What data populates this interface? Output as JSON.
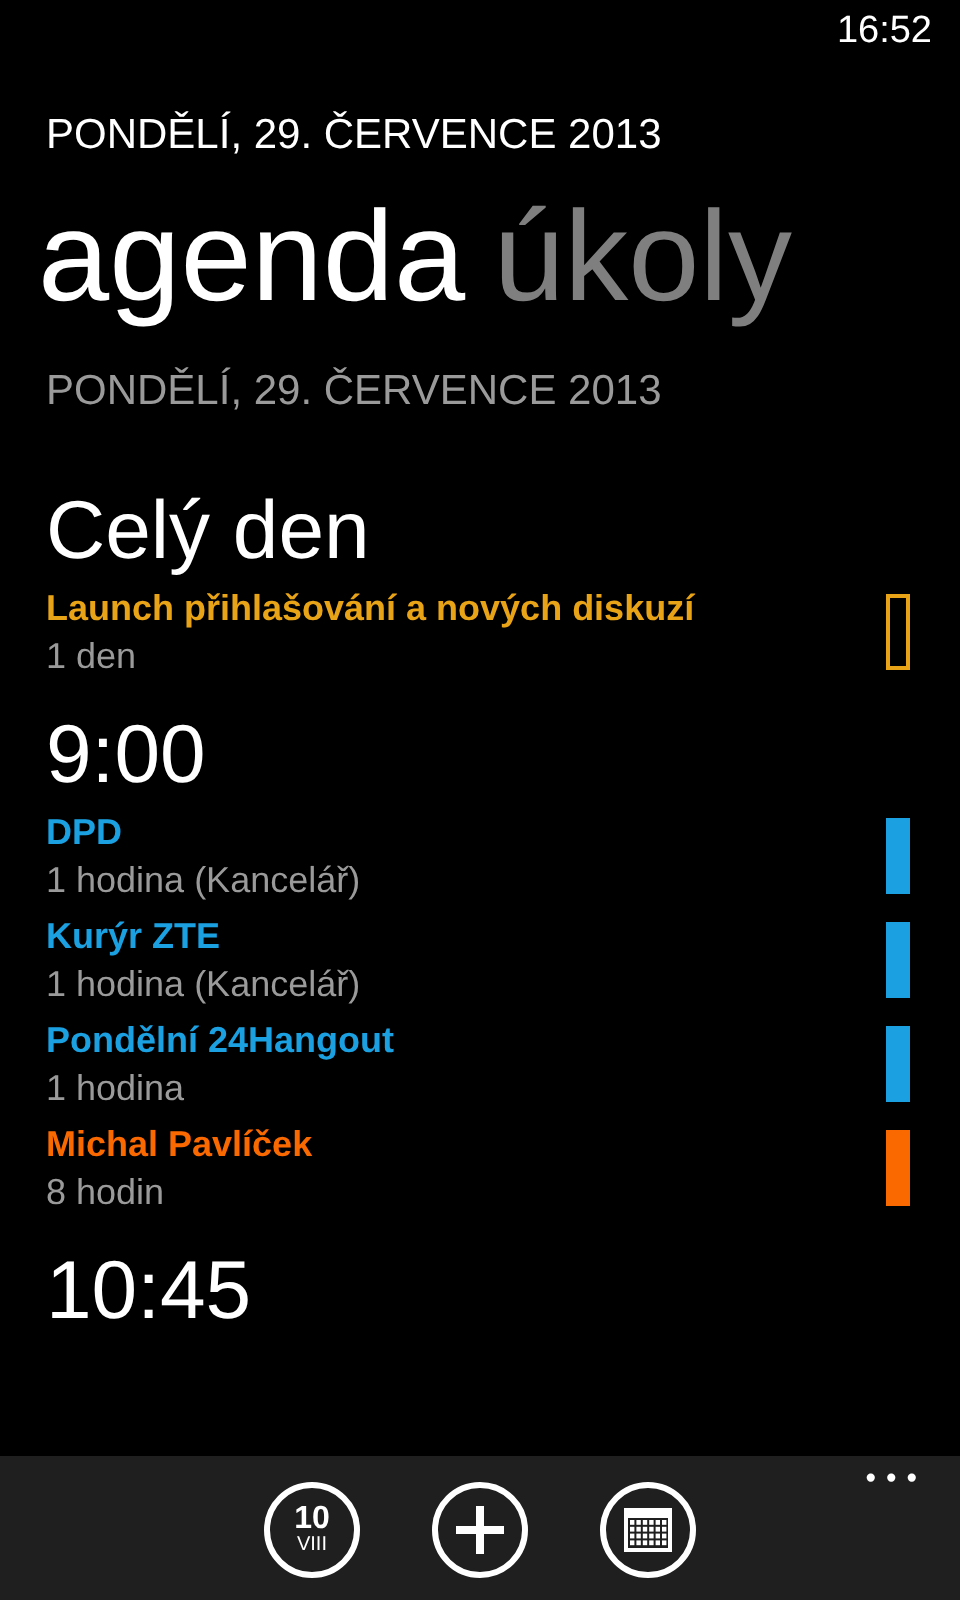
{
  "status_bar": {
    "time": "16:52"
  },
  "app_title": "PONDĚLÍ, 29. ČERVENCE 2013",
  "pivots": [
    {
      "label": "agenda",
      "selected": true
    },
    {
      "label": "úkoly",
      "selected": false
    }
  ],
  "day_heading": "PONDĚLÍ, 29. ČERVENCE 2013",
  "groups": [
    {
      "heading": "Celý den",
      "events": [
        {
          "title": "Launch přihlašování a nových diskuzí",
          "detail": "1 den",
          "color": "#e8a317",
          "busy": false
        }
      ]
    },
    {
      "heading": "9:00",
      "events": [
        {
          "title": "DPD",
          "detail": "1 hodina (Kancelář)",
          "color": "#1ba1e2",
          "busy": true
        },
        {
          "title": "Kurýr ZTE",
          "detail": "1 hodina (Kancelář)",
          "color": "#1ba1e2",
          "busy": true
        },
        {
          "title": "Pondělní 24Hangout",
          "detail": "1 hodina",
          "color": "#1ba1e2",
          "busy": true
        },
        {
          "title": "Michal Pavlíček",
          "detail": "8 hodin",
          "color": "#fa6800",
          "busy": true
        }
      ]
    },
    {
      "heading": "10:45"
    }
  ],
  "app_bar": {
    "buttons": [
      {
        "kind": "date",
        "day": "10",
        "month": "VIII"
      },
      {
        "kind": "add"
      },
      {
        "kind": "calendar"
      }
    ],
    "more": "•••"
  }
}
